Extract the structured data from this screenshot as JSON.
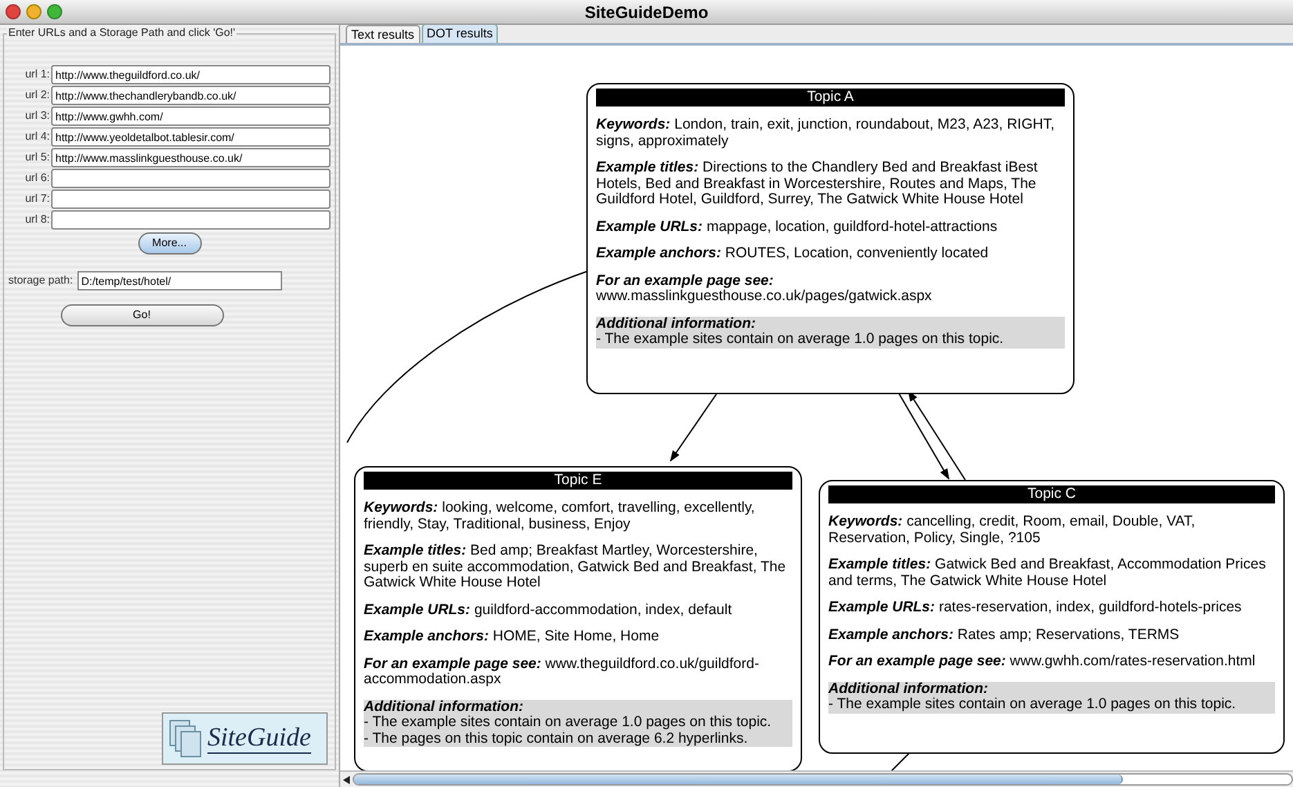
{
  "window": {
    "title": "SiteGuideDemo"
  },
  "input_panel": {
    "legend": "Enter URLs and a Storage Path and click 'Go!'",
    "urls": [
      {
        "label": "url 1:",
        "value": "http://www.theguildford.co.uk/"
      },
      {
        "label": "url 2:",
        "value": "http://www.thechandlerybandb.co.uk/"
      },
      {
        "label": "url 3:",
        "value": "http://www.gwhh.com/"
      },
      {
        "label": "url 4:",
        "value": "http://www.yeoldetalbot.tablesir.com/"
      },
      {
        "label": "url 5:",
        "value": "http://www.masslinkguesthouse.co.uk/"
      },
      {
        "label": "url 6:"
      },
      {
        "label": "url 7:"
      },
      {
        "label": "url 8:"
      }
    ],
    "more_button": "More...",
    "storage_path": {
      "label": "storage path:",
      "value": "D:/temp/test/hotel/"
    },
    "go_button": "Go!",
    "logo": "SiteGuide"
  },
  "tabs": [
    {
      "label": "Text results",
      "selected": false
    },
    {
      "label": "DOT results",
      "selected": true
    }
  ],
  "topics": [
    {
      "title": "Topic A",
      "sections": [
        {
          "label": "Keywords:",
          "text": "London, train, exit, junction, roundabout, M23, A23, RIGHT, signs, approximately"
        },
        {
          "label": "Example titles:",
          "text": "Directions to the Chandlery Bed and Breakfast iBest Hotels, Bed and Breakfast in Worcestershire, Routes and Maps, The Guildford Hotel, Guildford, Surrey, The Gatwick White House Hotel"
        },
        {
          "label": "Example URLs:",
          "text": "mappage, location, guildford-hotel-attractions"
        },
        {
          "label": "Example anchors:",
          "text": "ROUTES, Location, conveniently located"
        },
        {
          "label": "For an example page see:",
          "text": "www.masslinkguesthouse.co.uk/pages/gatwick.aspx"
        }
      ],
      "additional": {
        "label": "Additional information:",
        "lines": [
          "- The example sites contain on average 1.0 pages on this topic."
        ]
      }
    },
    {
      "title": "Topic E",
      "sections": [
        {
          "label": "Keywords:",
          "text": "looking, welcome, comfort, travelling, excellently, friendly, Stay, Traditional, business, Enjoy"
        },
        {
          "label": "Example titles:",
          "text": "Bed amp; Breakfast Martley, Worcestershire, superb en suite accommodation, Gatwick Bed and Breakfast, The Gatwick White House Hotel"
        },
        {
          "label": "Example URLs:",
          "text": "guildford-accommodation, index, default"
        },
        {
          "label": "Example anchors:",
          "text": "HOME, Site Home, Home"
        },
        {
          "label": "For an example page see:",
          "text": "www.theguildford.co.uk/guildford-accommodation.aspx"
        }
      ],
      "additional": {
        "label": "Additional information:",
        "lines": [
          "- The example sites contain on average 1.0 pages on this topic.",
          "- The pages on this topic contain on average 6.2 hyperlinks."
        ]
      }
    },
    {
      "title": "Topic C",
      "sections": [
        {
          "label": "Keywords:",
          "text": "cancelling, credit, Room, email, Double, VAT, Reservation, Policy, Single, ?105"
        },
        {
          "label": "Example titles:",
          "text": "Gatwick Bed and Breakfast, Accommodation Prices and terms, The Gatwick White House Hotel"
        },
        {
          "label": "Example URLs:",
          "text": "rates-reservation, index, guildford-hotels-prices"
        },
        {
          "label": "Example anchors:",
          "text": "Rates amp; Reservations, TERMS"
        },
        {
          "label": "For an example page see:",
          "text": "www.gwhh.com/rates-reservation.html"
        }
      ],
      "additional": {
        "label": "Additional information:",
        "lines": [
          "- The example sites contain on average 1.0 pages on this topic."
        ]
      }
    }
  ]
}
